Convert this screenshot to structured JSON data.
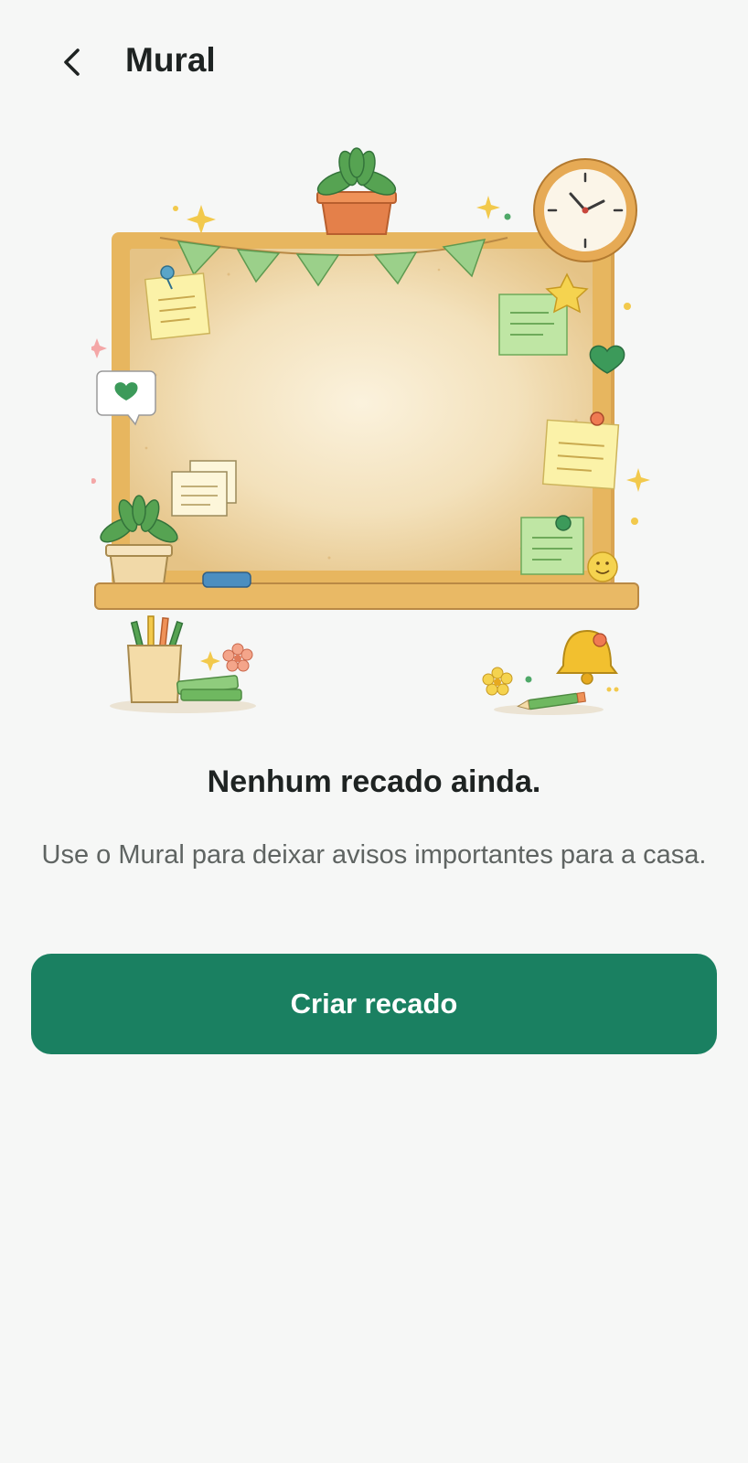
{
  "header": {
    "title": "Mural",
    "back_icon": "chevron-left-icon"
  },
  "illustration": {
    "name": "corkboard-illustration",
    "colors": {
      "frame": "#e7b65f",
      "cork": "#e9cc96",
      "cork_center": "#f7ebcf",
      "bunting": "#8fcc7d",
      "note_yellow": "#fbf2a8",
      "note_green": "#bfe6a4",
      "plant": "#56a352",
      "pot": "#e4804a",
      "clock": "#fbf5e8"
    }
  },
  "empty_state": {
    "title": "Nenhum recado ainda.",
    "description": "Use o Mural para deixar avisos importantes para a casa."
  },
  "actions": {
    "create_label": "Criar recado",
    "accent_color": "#1a8061"
  }
}
